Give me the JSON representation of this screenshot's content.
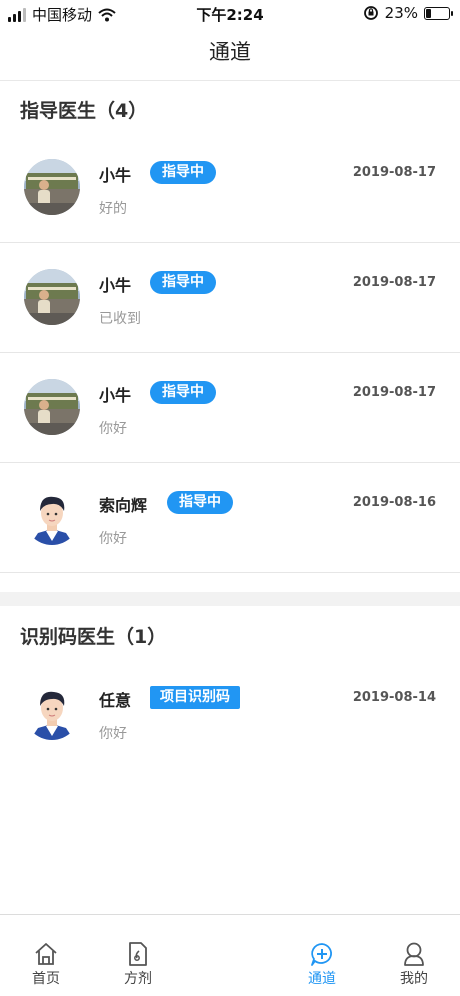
{
  "status_bar": {
    "carrier": "中国移动",
    "time": "下午2:24",
    "battery": "23%",
    "battery_level": 0.23
  },
  "nav": {
    "title": "通道"
  },
  "sections": [
    {
      "header": "指导医生（4）",
      "items": [
        {
          "name": "小牛",
          "tag": "指导中",
          "date": "2019-08-17",
          "message": "好的",
          "avatar": "photo"
        },
        {
          "name": "小牛",
          "tag": "指导中",
          "date": "2019-08-17",
          "message": "已收到",
          "avatar": "photo"
        },
        {
          "name": "小牛",
          "tag": "指导中",
          "date": "2019-08-17",
          "message": "你好",
          "avatar": "photo"
        },
        {
          "name": "索向辉",
          "tag": "指导中",
          "date": "2019-08-16",
          "message": "你好",
          "avatar": "cartoon"
        }
      ]
    },
    {
      "header": "识别码医生（1）",
      "items": [
        {
          "name": "任意",
          "tag": "项目识别码",
          "date": "2019-08-14",
          "message": "你好",
          "avatar": "cartoon"
        }
      ]
    }
  ],
  "tabbar": {
    "items": [
      {
        "label": "首页",
        "icon": "home-icon",
        "active": false
      },
      {
        "label": "方剂",
        "icon": "prescription-icon",
        "active": false
      },
      {
        "label": "通道",
        "icon": "chat-add-icon",
        "active": true
      },
      {
        "label": "我的",
        "icon": "user-icon",
        "active": false
      }
    ]
  },
  "colors": {
    "accent": "#2196f3",
    "muted_text": "#999999",
    "divider": "#e6e6e6"
  }
}
